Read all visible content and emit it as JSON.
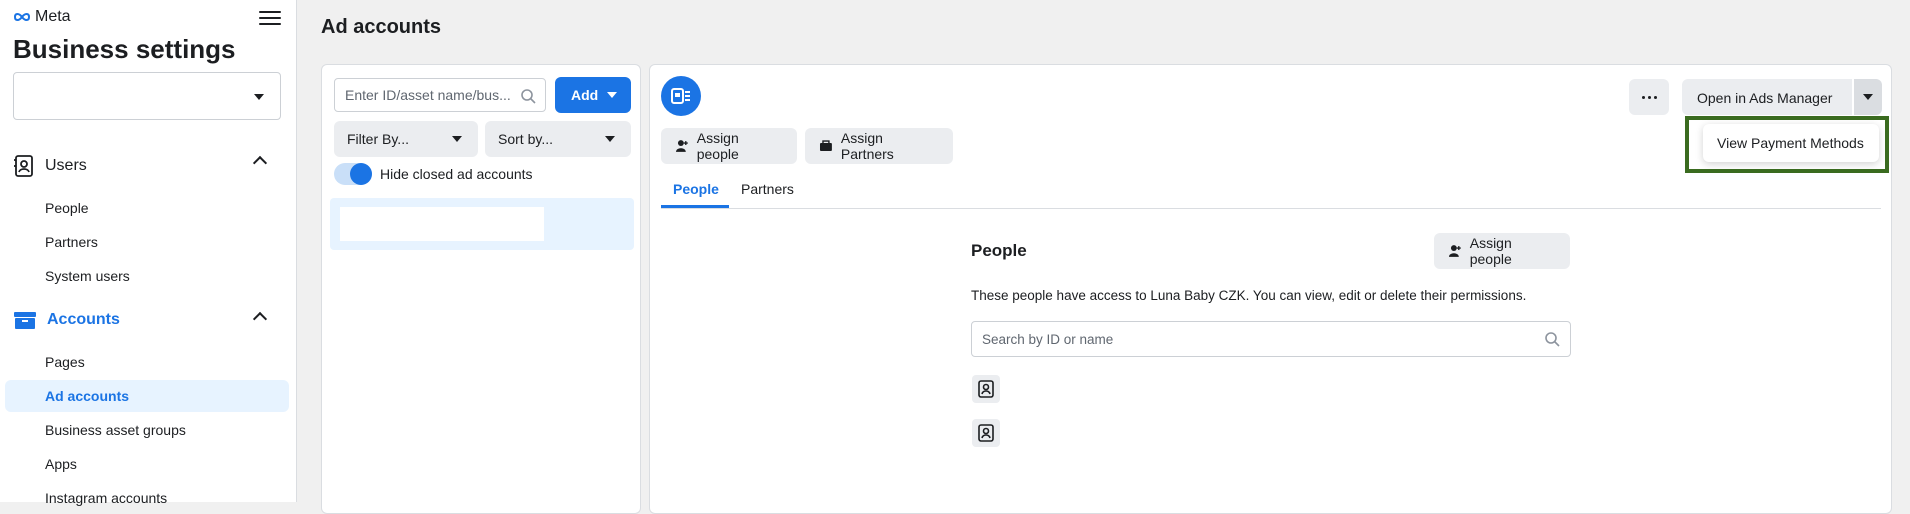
{
  "sidebar": {
    "brand": "Meta",
    "title": "Business settings",
    "business_select_value": "",
    "users_section": "Users",
    "users_items": [
      "People",
      "Partners",
      "System users"
    ],
    "accounts_section": "Accounts",
    "accounts_items": [
      "Pages",
      "Ad accounts",
      "Business asset groups",
      "Apps",
      "Instagram accounts"
    ],
    "active_item": "Ad accounts"
  },
  "page": {
    "title": "Ad accounts"
  },
  "list_panel": {
    "search_placeholder": "Enter ID/asset name/bus...",
    "add_label": "Add",
    "filter_label": "Filter By...",
    "sort_label": "Sort by...",
    "toggle_label": "Hide closed ad accounts",
    "toggle_on": true
  },
  "detail": {
    "assign_people_label": "Assign people",
    "assign_partners_label": "Assign Partners",
    "tabs": [
      "People",
      "Partners"
    ],
    "active_tab": "People",
    "open_ads_manager_label": "Open in Ads Manager",
    "dropdown_item": "View Payment Methods",
    "people_title": "People",
    "people_assign_label": "Assign people",
    "people_description": "These people have access to Luna Baby CZK. You can view, edit or delete their permissions.",
    "people_search_placeholder": "Search by ID or name"
  },
  "colors": {
    "accent": "#1b74e4",
    "highlight": "#3a6b1f"
  }
}
